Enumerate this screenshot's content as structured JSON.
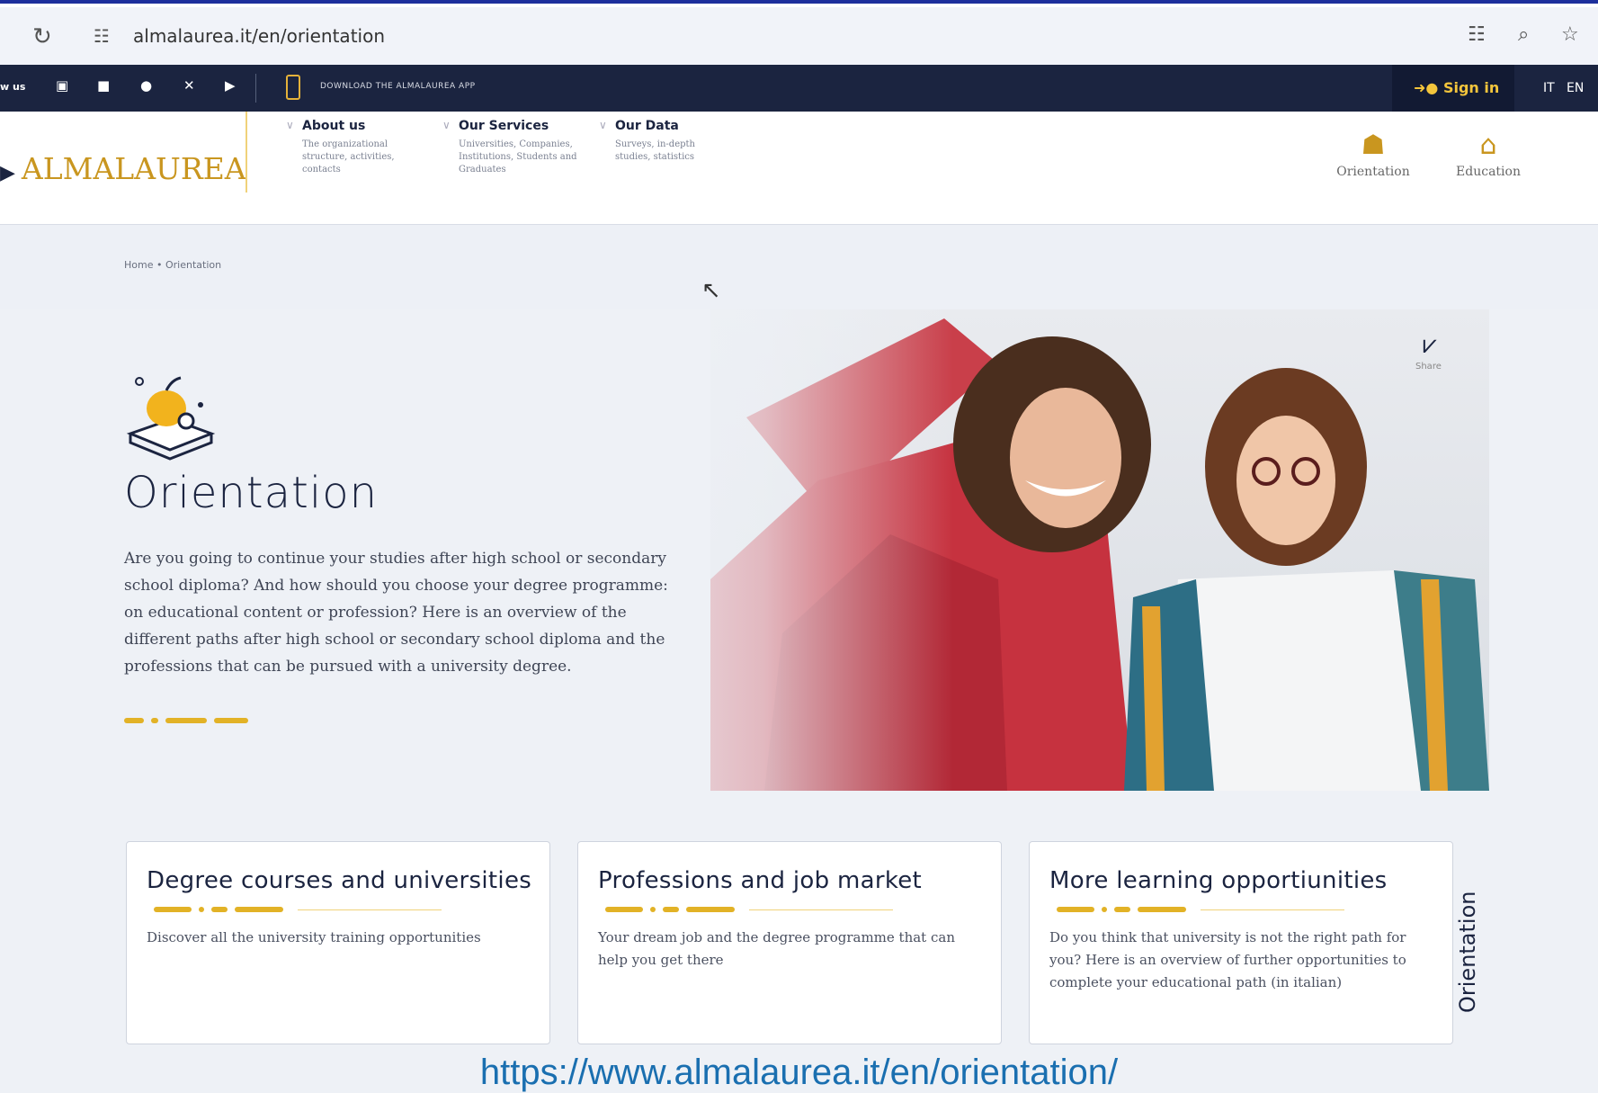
{
  "browser": {
    "url": "almalaurea.it/en/orientation"
  },
  "topstrip": {
    "left_text": "w us",
    "download_app": "DOWNLOAD THE ALMALAUREA APP",
    "signin": "Sign in",
    "lang_it": "IT",
    "lang_en": "EN"
  },
  "nav": {
    "logo": "ALMALAUREA",
    "menus": [
      {
        "title": "About us",
        "desc": "The organizational structure, activities, contacts"
      },
      {
        "title": "Our Services",
        "desc": "Universities, Companies, Institutions, Students and Graduates"
      },
      {
        "title": "Our Data",
        "desc": "Surveys, in-depth studies, statistics"
      }
    ],
    "categories": [
      {
        "label": "Orientation",
        "icon": "orientation-icon"
      },
      {
        "label": "Education",
        "icon": "education-icon"
      }
    ]
  },
  "breadcrumb": {
    "home": "Home",
    "current": "Orientation"
  },
  "hero": {
    "title": "Orientation",
    "text": "Are you going to continue your studies after high school or secondary school diploma? And how should you choose your degree programme: on educational content or profession? Here is an overview of the different paths after high school or secondary school diploma and the professions that can be pursued with a university degree.",
    "share": "Share"
  },
  "cards": [
    {
      "title": "Degree courses and universities",
      "text": "Discover all the university training opportunities"
    },
    {
      "title": "Professions and job market",
      "text": "Your dream job and the degree programme that can help you get there"
    },
    {
      "title": "More learning opportiunities",
      "text": "Do you think that university is not the right path for you? Here is an overview of further opportunities to complete your educational path (in italian)"
    }
  ],
  "side_label": "Orientation",
  "caption": "https://www.almalaurea.it/en/orientation/",
  "colors": {
    "accent": "#e2b226",
    "navy": "#1b2440",
    "frame": "#1d2f9c"
  }
}
